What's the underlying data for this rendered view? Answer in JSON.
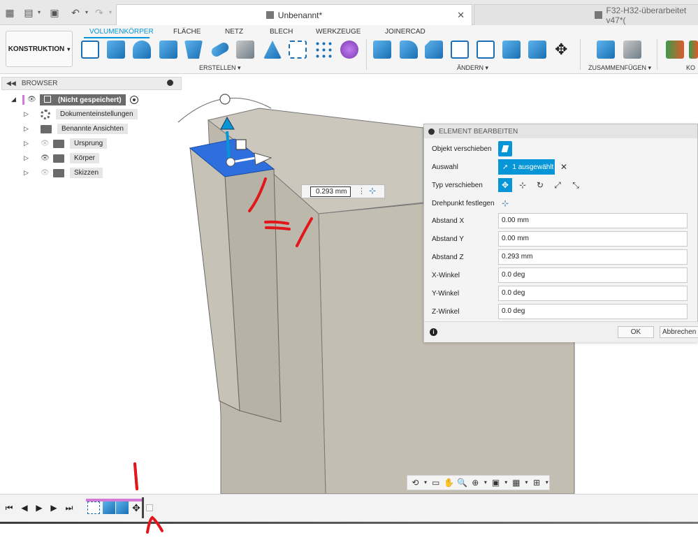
{
  "titlebar": {
    "active_tab": "Unbenannt*",
    "inactive_tab": "F32-H32-überarbeitet v47*(",
    "icons": [
      "grid-icon",
      "file-icon",
      "save-icon",
      "undo-icon",
      "redo-icon"
    ]
  },
  "ribbon": {
    "workspace": "KONSTRUKTION",
    "tabs": [
      "VOLUMENKÖRPER",
      "FLÄCHE",
      "NETZ",
      "BLECH",
      "WERKZEUGE",
      "JOINERCAD"
    ],
    "active_tab": "VOLUMENKÖRPER",
    "groups": [
      "ERSTELLEN",
      "ÄNDERN",
      "ZUSAMMENFÜGEN",
      "KO"
    ]
  },
  "browser": {
    "title": "BROWSER",
    "root": "(Nicht gespeichert)",
    "items": [
      {
        "label": "Dokumenteinstellungen",
        "icon": "gear-icon",
        "visible": true
      },
      {
        "label": "Benannte Ansichten",
        "icon": "folder-icon",
        "visible": true
      },
      {
        "label": "Ursprung",
        "icon": "folder-icon",
        "visible": false
      },
      {
        "label": "Körper",
        "icon": "folder-icon",
        "visible": true
      },
      {
        "label": "Skizzen",
        "icon": "folder-icon",
        "visible": false
      }
    ]
  },
  "manipulator": {
    "value": "0.293 mm"
  },
  "dialog": {
    "title": "ELEMENT BEARBEITEN",
    "rows": {
      "move_object": "Objekt verschieben",
      "selection": "Auswahl",
      "selection_value": "1 ausgewählt",
      "move_type": "Typ verschieben",
      "pivot": "Drehpunkt festlegen",
      "dist_x_label": "Abstand X",
      "dist_x": "0.00 mm",
      "dist_y_label": "Abstand Y",
      "dist_y": "0.00 mm",
      "dist_z_label": "Abstand Z",
      "dist_z": "0.293 mm",
      "ang_x_label": "X-Winkel",
      "ang_x": "0.0 deg",
      "ang_y_label": "Y-Winkel",
      "ang_y": "0.0 deg",
      "ang_z_label": "Z-Winkel",
      "ang_z": "0.0 deg"
    },
    "ok": "OK",
    "cancel": "Abbrechen"
  },
  "colors": {
    "accent": "#0696d7",
    "body_top": "#cac6bb",
    "body_front": "#c4bfb3",
    "body_side": "#b3aea2",
    "selected_face": "#2f6fdd",
    "annotation": "#e2171c",
    "timeline_strip": "#d47ad6"
  }
}
